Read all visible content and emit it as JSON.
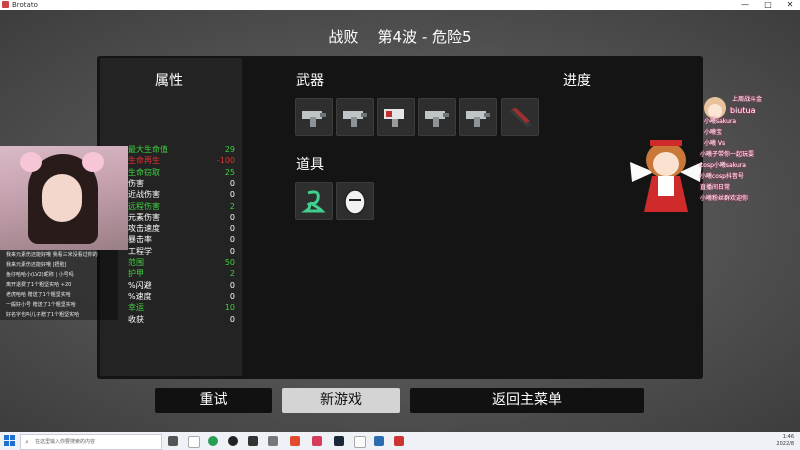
{
  "window": {
    "title": "Brotato",
    "controls": [
      "—",
      "□",
      "✕"
    ]
  },
  "header": {
    "result": "战败",
    "wave": "第4波 - 危险5"
  },
  "stats": {
    "title": "属性",
    "rows": [
      {
        "label": "最大生命值",
        "value": "29",
        "color": "#3fd13f"
      },
      {
        "label": "生命再生",
        "value": "-100",
        "color": "#e03030"
      },
      {
        "label": "生命窃取",
        "value": "25",
        "color": "#3fd13f"
      },
      {
        "label": "伤害",
        "value": "0",
        "color": "#ffffff"
      },
      {
        "label": "近战伤害",
        "value": "0",
        "color": "#ffffff"
      },
      {
        "label": "远程伤害",
        "value": "2",
        "color": "#3fd13f"
      },
      {
        "label": "元素伤害",
        "value": "0",
        "color": "#ffffff"
      },
      {
        "label": "攻击速度",
        "value": "0",
        "color": "#ffffff"
      },
      {
        "label": "暴击率",
        "value": "0",
        "color": "#ffffff"
      },
      {
        "label": "工程学",
        "value": "0",
        "color": "#ffffff"
      },
      {
        "label": "范围",
        "value": "50",
        "color": "#3fd13f"
      },
      {
        "label": "护甲",
        "value": "2",
        "color": "#3fd13f"
      },
      {
        "label": "%闪避",
        "value": "0",
        "color": "#ffffff"
      },
      {
        "label": "%速度",
        "value": "0",
        "color": "#ffffff"
      },
      {
        "label": "幸运",
        "value": "10",
        "color": "#3fd13f"
      },
      {
        "label": "收获",
        "value": "0",
        "color": "#ffffff"
      }
    ]
  },
  "weapons": {
    "title": "武器",
    "slots": [
      "smg-icon",
      "smg-icon",
      "shredder-icon",
      "smg-icon",
      "smg-icon",
      "minigun-icon"
    ]
  },
  "progress": {
    "title": "进度"
  },
  "items": {
    "title": "道具",
    "slots": [
      "green-swirl-icon",
      "egg-face-icon"
    ]
  },
  "buttons": {
    "retry": "重试",
    "new_game": "新游戏",
    "main_menu": "返回主菜单"
  },
  "stream_overlay": {
    "chat": [
      "我来元素伤还能好哦 我看三米没看过你的",
      "我来元素伤还能好哦 [捂脸]",
      "鱼仔哈哈小(LV2)昵称 | 小号吗",
      "离开退费了1个粗坚实哈 +20",
      "老虎哈哈 赠送了1个粗坚实哈",
      "一般好小号 赠送了1个粗坚实哈",
      "好名字也叫儿子赠了1个粗坚实哈"
    ],
    "fans": [
      "上周战斗金",
      "biutua",
      "小曦sakura",
      "小曦宝",
      "小曦 Vs",
      "小曦子带你一起玩耍",
      "cosp小曦sakura",
      "小曦cosp抖音号",
      "直播间日常",
      "小曦粉丝群欢迎你"
    ]
  },
  "taskbar": {
    "search_placeholder": "在这里输入你要搜索的内容",
    "clock_time": "1:46",
    "clock_date": "2022/8"
  }
}
